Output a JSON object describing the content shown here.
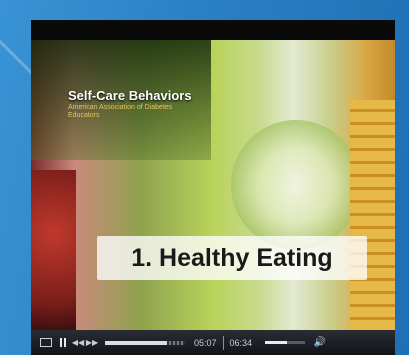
{
  "video": {
    "title": "Self-Care Behaviors",
    "subtitle": "American Association of Diabetes Educators",
    "caption": "1. Healthy Eating"
  },
  "controls": {
    "cc_icon": "closed-captions-icon",
    "play_state_icon": "pause-icon",
    "prev_icon": "previous-icon",
    "next_icon": "next-icon",
    "prev_glyph": "◀◀",
    "next_glyph": "▶▶",
    "elapsed_time": "05:07",
    "total_time": "06:34",
    "progress_fraction": 0.78,
    "volume_fraction": 0.55,
    "volume_icon": "speaker-icon",
    "volume_glyph": "🔊"
  },
  "colors": {
    "page_background": "#2c83c6",
    "control_bar": "#1b1e24",
    "caption_box": "#ffffffc8",
    "subtitle_text": "#e8c45a"
  }
}
